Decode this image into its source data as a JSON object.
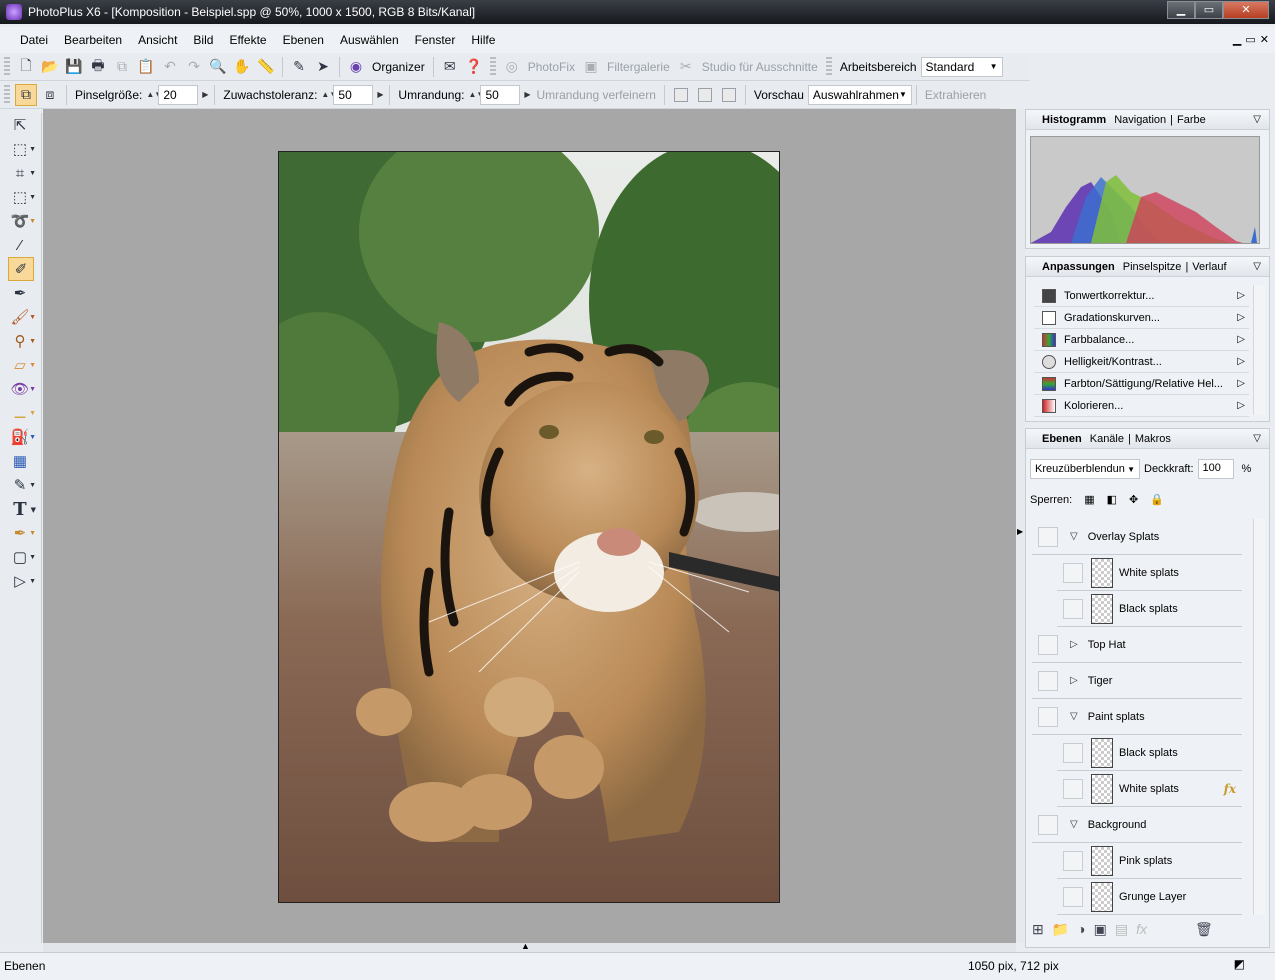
{
  "window": {
    "title": "PhotoPlus X6 - [Komposition - Beispiel.spp @ 50%, 1000 x 1500, RGB 8 Bits/Kanal]",
    "buttons": [
      "▁",
      "▭",
      "✕"
    ],
    "mdi_buttons": [
      "▁",
      "▭",
      "✕"
    ]
  },
  "menu": [
    "Datei",
    "Bearbeiten",
    "Ansicht",
    "Bild",
    "Effekte",
    "Ebenen",
    "Auswählen",
    "Fenster",
    "Hilfe"
  ],
  "toolbar1": {
    "organizer": "Organizer",
    "photofix": "PhotoFix",
    "filtergalerie": "Filtergalerie",
    "studio": "Studio für Ausschnitte",
    "arbeitsbereich_label": "Arbeitsbereich",
    "arbeitsbereich_value": "Standard"
  },
  "toolbar2": {
    "pinselgroesse_label": "Pinselgröße:",
    "pinselgroesse_value": "20",
    "zuwachstoleranz_label": "Zuwachstoleranz:",
    "zuwachstoleranz_value": "50",
    "umrandung_label": "Umrandung:",
    "umrandung_value": "50",
    "umrandung_verfeinern": "Umrandung verfeinern",
    "vorschau_label": "Vorschau",
    "vorschau_value": "Auswahlrahmen",
    "extrahieren": "Extrahieren"
  },
  "histogram_panel": {
    "tabs": [
      "Histogramm",
      "Navigation",
      "Farbe"
    ]
  },
  "adjust_panel": {
    "tabs": [
      "Anpassungen",
      "Pinselspitze",
      "Verlauf"
    ],
    "items": [
      "Tonwertkorrektur...",
      "Gradationskurven...",
      "Farbbalance...",
      "Helligkeit/Kontrast...",
      "Farbton/Sättigung/Relative Hel...",
      "Kolorieren..."
    ]
  },
  "layers_panel": {
    "tabs": [
      "Ebenen",
      "Kanäle",
      "Makros"
    ],
    "blend_mode": "Kreuzüberblendun",
    "deckkraft_label": "Deckkraft:",
    "deckkraft_value": "100",
    "percent": "%",
    "sperren_label": "Sperren:",
    "layers": [
      {
        "name": "Overlay Splats",
        "expander": "▽"
      },
      {
        "name": "White splats"
      },
      {
        "name": "Black splats"
      },
      {
        "name": "Top Hat",
        "expander": "▷"
      },
      {
        "name": "Tiger",
        "expander": "▷"
      },
      {
        "name": "Paint splats",
        "expander": "▽"
      },
      {
        "name": "Black splats"
      },
      {
        "name": "White splats",
        "fx": "fx"
      },
      {
        "name": "Background",
        "expander": "▽"
      },
      {
        "name": "Pink splats"
      },
      {
        "name": "Grunge Layer"
      }
    ]
  },
  "status": {
    "left": "Ebenen",
    "right": "1050 pix, 712 pix"
  },
  "colors": {
    "canvas_bg": "#a7a7a7",
    "active_tool": "#f8d999",
    "titlebar": "#1f2328"
  }
}
